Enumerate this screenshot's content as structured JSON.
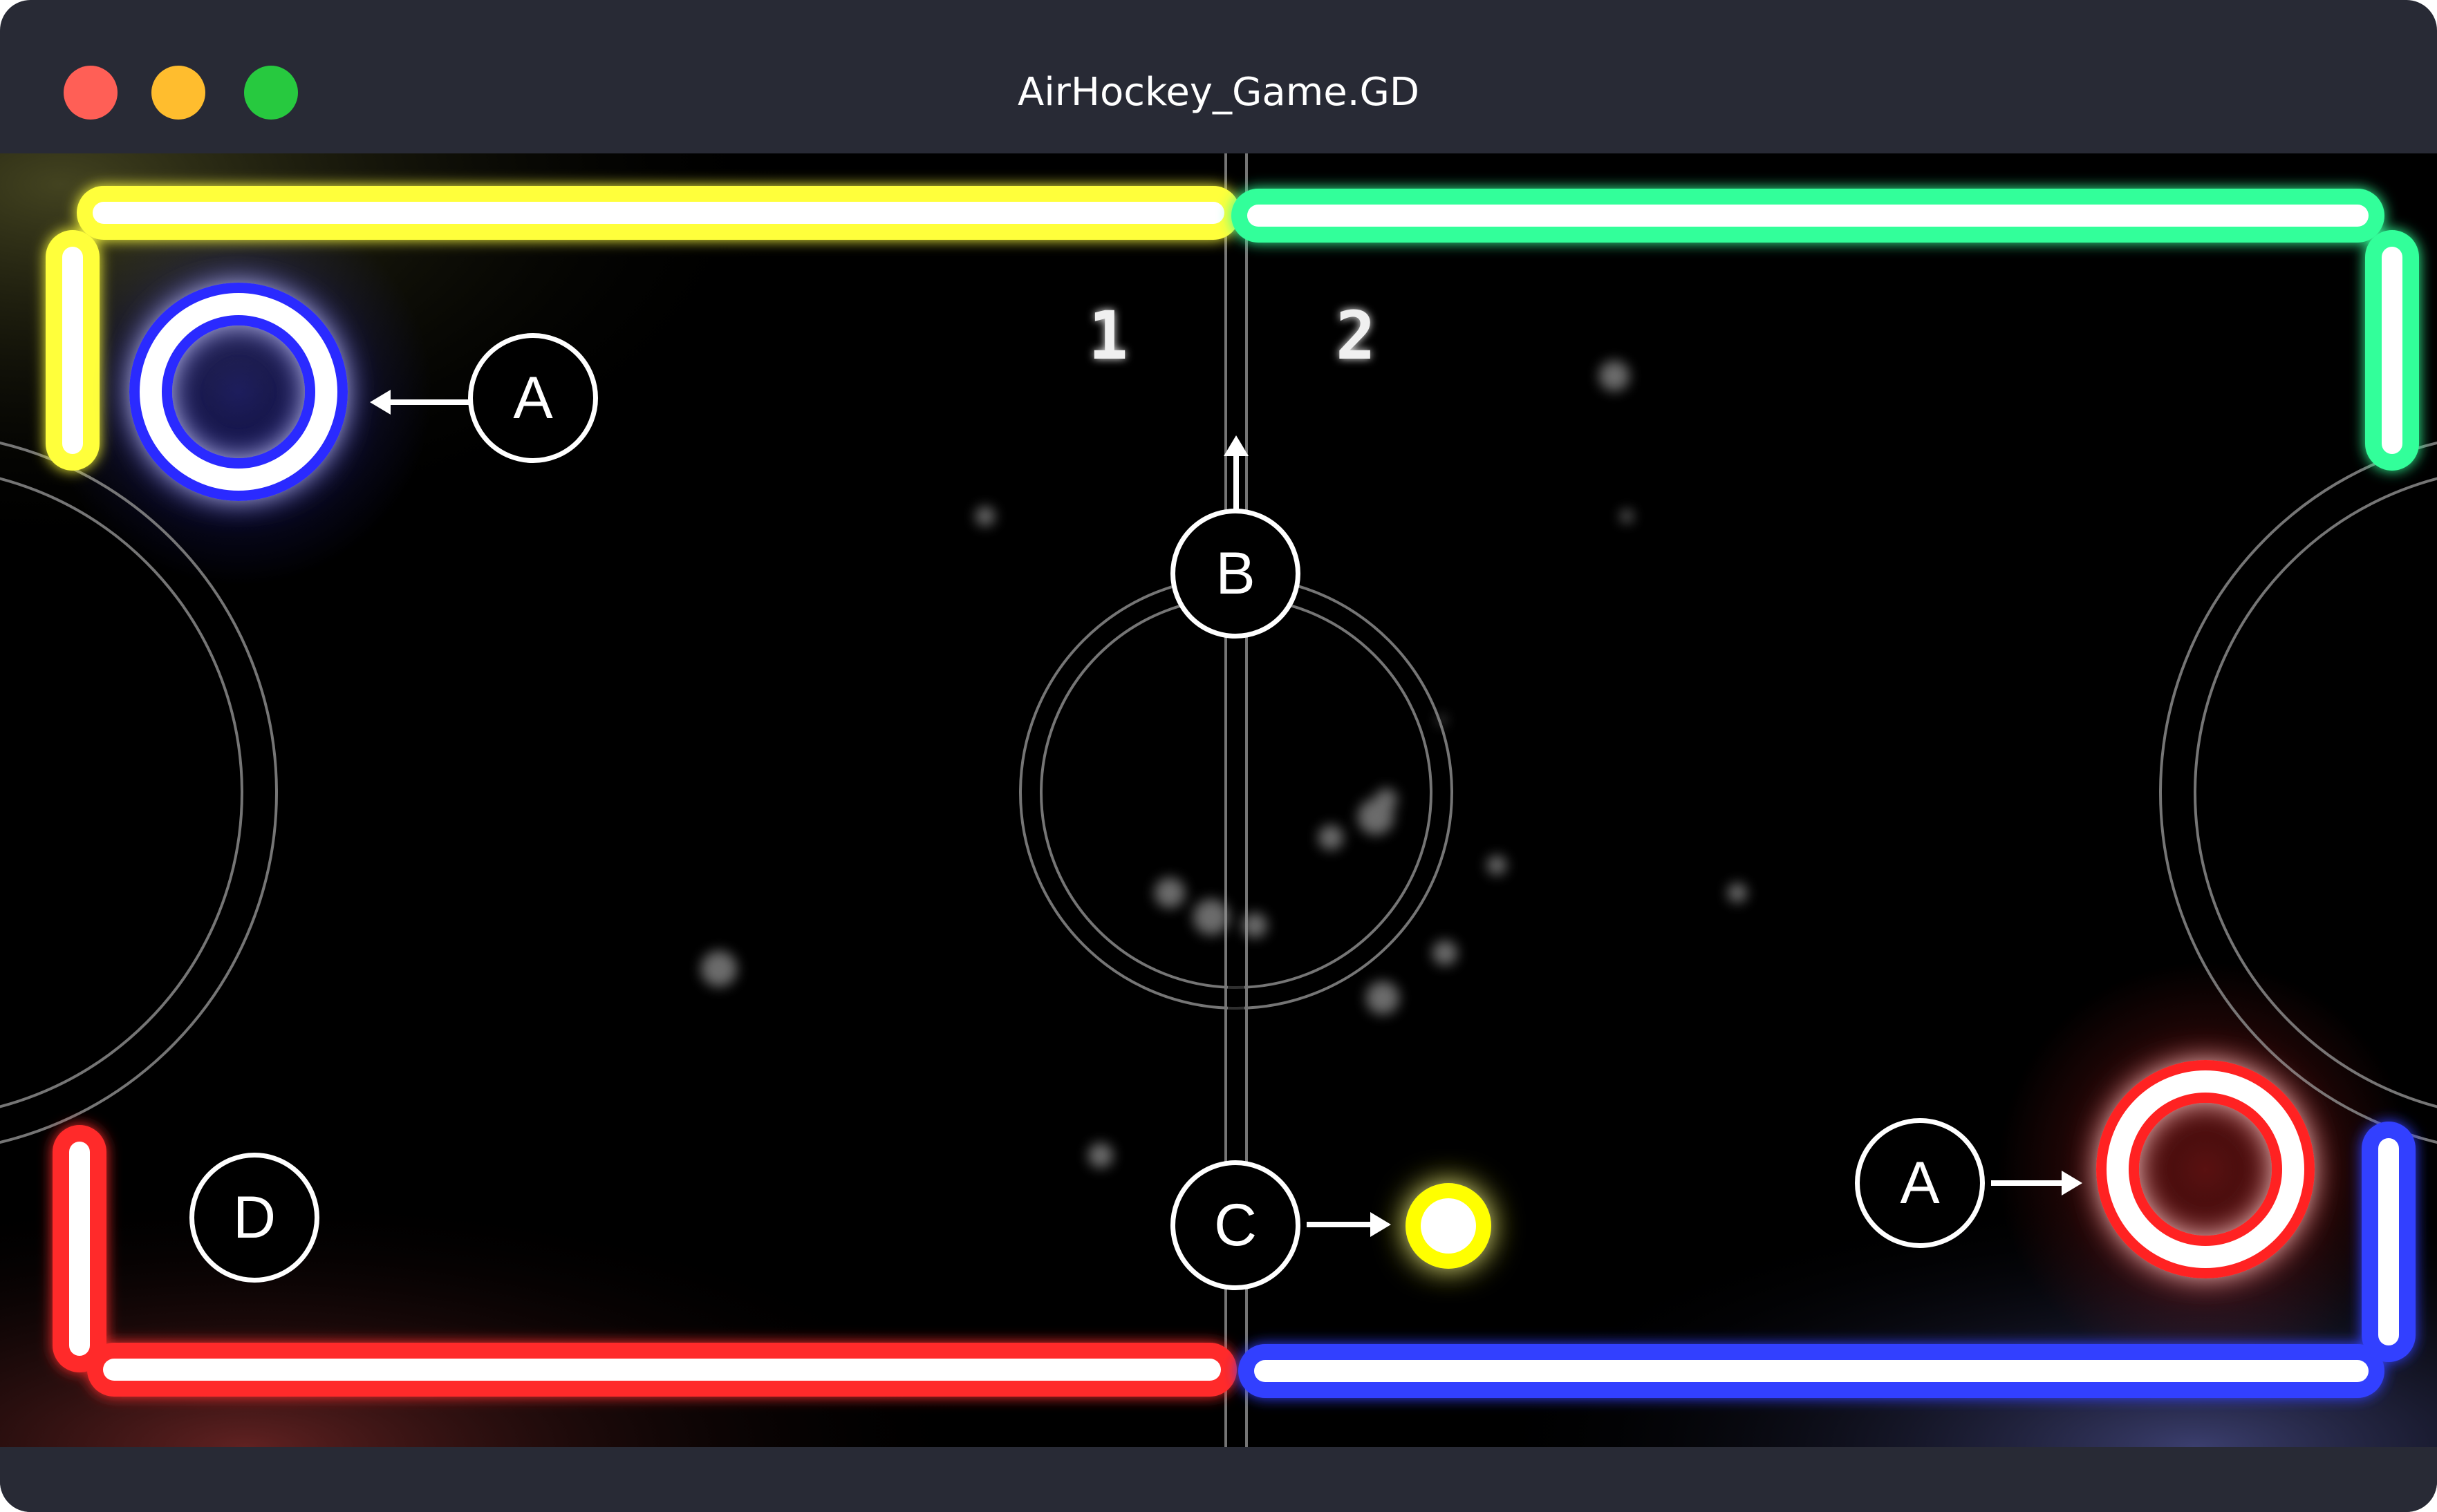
{
  "window": {
    "title": "AirHockey_Game.GD",
    "controls": [
      "close",
      "minimize",
      "maximize"
    ]
  },
  "scoreboard": {
    "player1": "1",
    "player2": "2"
  },
  "board": {
    "walls": {
      "top_left": "#ffff3a",
      "top_right": "#33ff9a",
      "bottom_left": "#ff2a2a",
      "bottom_right": "#3340ff"
    },
    "mallet_left_color": "#2a2aff",
    "mallet_right_color": "#ff2020",
    "puck_color": "#ffff00"
  },
  "callouts": {
    "mallet_left": "A",
    "center_line": "B",
    "puck": "C",
    "mallet_right": "A",
    "wall": "D"
  }
}
